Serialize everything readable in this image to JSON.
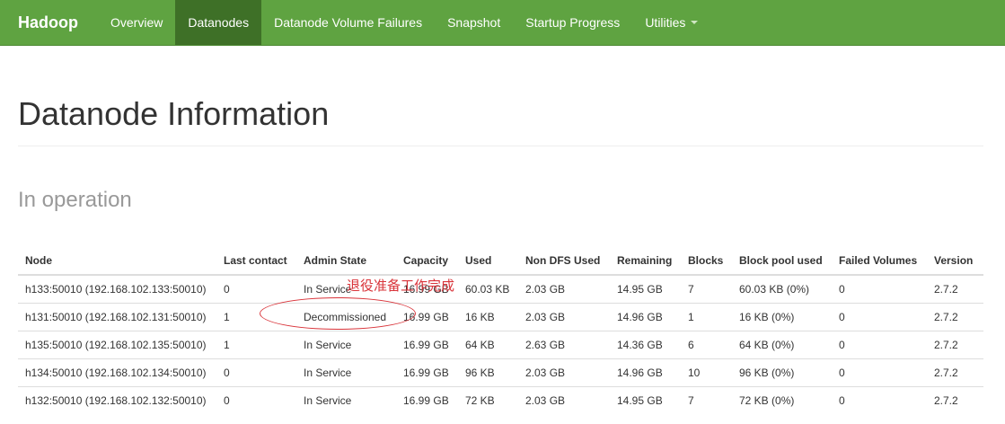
{
  "navbar": {
    "brand": "Hadoop",
    "items": [
      {
        "label": "Overview"
      },
      {
        "label": "Datanodes"
      },
      {
        "label": "Datanode Volume Failures"
      },
      {
        "label": "Snapshot"
      },
      {
        "label": "Startup Progress"
      },
      {
        "label": "Utilities"
      }
    ],
    "active": "Datanodes"
  },
  "page": {
    "title": "Datanode Information",
    "section": "In operation"
  },
  "table": {
    "headers": [
      "Node",
      "Last contact",
      "Admin State",
      "Capacity",
      "Used",
      "Non DFS Used",
      "Remaining",
      "Blocks",
      "Block pool used",
      "Failed Volumes",
      "Version"
    ],
    "rows": [
      [
        "h133:50010 (192.168.102.133:50010)",
        "0",
        "In Service",
        "16.99 GB",
        "60.03 KB",
        "2.03 GB",
        "14.95 GB",
        "7",
        "60.03 KB (0%)",
        "0",
        "2.7.2"
      ],
      [
        "h131:50010 (192.168.102.131:50010)",
        "1",
        "Decommissioned",
        "16.99 GB",
        "16 KB",
        "2.03 GB",
        "14.96 GB",
        "1",
        "16 KB (0%)",
        "0",
        "2.7.2"
      ],
      [
        "h135:50010 (192.168.102.135:50010)",
        "1",
        "In Service",
        "16.99 GB",
        "64 KB",
        "2.63 GB",
        "14.36 GB",
        "6",
        "64 KB (0%)",
        "0",
        "2.7.2"
      ],
      [
        "h134:50010 (192.168.102.134:50010)",
        "0",
        "In Service",
        "16.99 GB",
        "96 KB",
        "2.03 GB",
        "14.96 GB",
        "10",
        "96 KB (0%)",
        "0",
        "2.7.2"
      ],
      [
        "h132:50010 (192.168.102.132:50010)",
        "0",
        "In Service",
        "16.99 GB",
        "72 KB",
        "2.03 GB",
        "14.95 GB",
        "7",
        "72 KB (0%)",
        "0",
        "2.7.2"
      ]
    ]
  },
  "annotation": {
    "text": "退役准备工作完成",
    "color": "#d9343a"
  },
  "colors": {
    "navbar": "#5fa341",
    "navbar_active": "#3e7027"
  }
}
